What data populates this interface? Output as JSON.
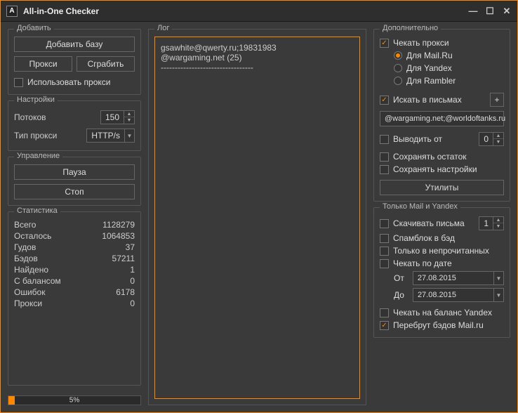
{
  "window": {
    "title": "All-in-One Checker"
  },
  "left": {
    "add": {
      "title": "Добавить",
      "add_base": "Добавить базу",
      "proxy": "Прокси",
      "grab": "Сграбить",
      "use_proxy": "Использовать прокси"
    },
    "settings": {
      "title": "Настройки",
      "threads_label": "Потоков",
      "threads_value": "150",
      "proxy_type_label": "Тип прокси",
      "proxy_type_value": "HTTP/s"
    },
    "control": {
      "title": "Управление",
      "pause": "Пауза",
      "stop": "Стоп"
    },
    "stats": {
      "title": "Статистика",
      "rows": [
        {
          "label": "Всего",
          "value": "1128279"
        },
        {
          "label": "Осталось",
          "value": "1064853"
        },
        {
          "label": "Гудов",
          "value": "37"
        },
        {
          "label": "Бэдов",
          "value": "57211"
        },
        {
          "label": "Найдено",
          "value": "1"
        },
        {
          "label": "С балансом",
          "value": "0"
        },
        {
          "label": "Ошибок",
          "value": "6178"
        },
        {
          "label": "Прокси",
          "value": "0"
        }
      ],
      "progress_pct": 5,
      "progress_label": "5%"
    }
  },
  "log": {
    "title": "Лог",
    "content": "gsawhite@qwerty.ru;19831983\n@wargaming.net (25)\n---------------------------------"
  },
  "right": {
    "extra": {
      "title": "Дополнительно",
      "check_proxy": "Чекать прокси",
      "for_mail": "Для Mail.Ru",
      "for_yandex": "Для Yandex",
      "for_rambler": "Для Rambler",
      "search_mails": "Искать в письмах",
      "search_mask": "@wargaming.net;@worldoftanks.ru",
      "output_from": "Выводить от",
      "output_from_value": "0",
      "save_rest": "Сохранять остаток",
      "save_settings": "Сохранять настройки",
      "utilities": "Утилиты"
    },
    "mailyandex": {
      "title": "Только Mail и Yandex",
      "download_letters": "Скачивать письма",
      "download_letters_value": "1",
      "spamblock": "Спамблок в бэд",
      "unread_only": "Только в непрочитанных",
      "check_date": "Чекать по дате",
      "from_label": "От",
      "from_value": "27.08.2015",
      "to_label": "До",
      "to_value": "27.08.2015",
      "check_balance_yandex": "Чекать на баланс Yandex",
      "rebrute_bad_mail": "Перебрут бэдов Mail.ru"
    }
  }
}
